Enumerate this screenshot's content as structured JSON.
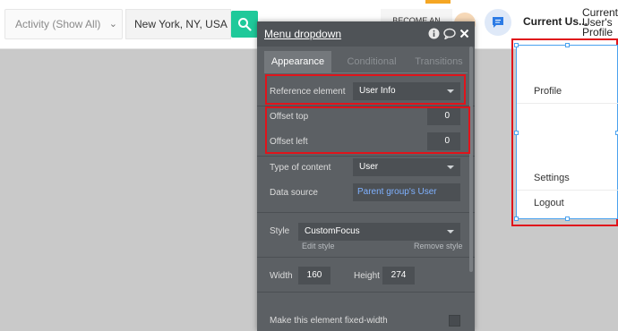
{
  "topbar": {
    "activity_select": "Activity (Show All)",
    "location_input": "New York, NY, USA",
    "become_button": "BECOME AN",
    "current_user": "Current Us...",
    "current_profile": "Current\nUser's\nProfile"
  },
  "panel": {
    "title": "Menu dropdown",
    "tabs": [
      {
        "label": "Appearance"
      },
      {
        "label": "Conditional"
      },
      {
        "label": "Transitions"
      }
    ],
    "reference_element": {
      "label": "Reference element",
      "value": "User Info"
    },
    "offset_top": {
      "label": "Offset top",
      "value": "0"
    },
    "offset_left": {
      "label": "Offset left",
      "value": "0"
    },
    "type_of_content": {
      "label": "Type of content",
      "value": "User"
    },
    "data_source": {
      "label": "Data source",
      "value": "Parent group's User"
    },
    "style": {
      "label": "Style",
      "value": "CustomFocus",
      "edit_link": "Edit style",
      "remove_link": "Remove style"
    },
    "width": {
      "label": "Width",
      "value": "160"
    },
    "height": {
      "label": "Height",
      "value": "274"
    },
    "fixed_width": {
      "label": "Make this element fixed-width"
    }
  },
  "preview": {
    "items": [
      {
        "label": "Profile"
      },
      {
        "label": "Settings"
      },
      {
        "label": "Logout"
      }
    ]
  },
  "colors": {
    "accent_green": "#1fc99a",
    "highlight_red": "#e0141b",
    "panel_bg": "#5c6064",
    "link_blue": "#7fb1ff",
    "selection_blue": "#4aa2ef"
  }
}
